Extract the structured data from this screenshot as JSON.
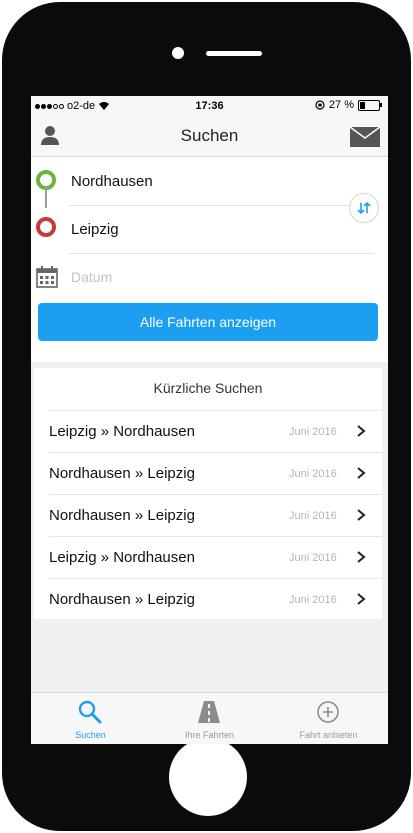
{
  "statusbar": {
    "carrier": "o2-de",
    "time": "17:36",
    "battery": "27 %"
  },
  "navbar": {
    "title": "Suchen"
  },
  "search": {
    "from": "Nordhausen",
    "to": "Leipzig",
    "date_placeholder": "Datum",
    "submit_label": "Alle Fahrten anzeigen"
  },
  "recent": {
    "title": "Kürzliche Suchen",
    "items": [
      {
        "route": "Leipzig » Nordhausen",
        "date": "Juni 2016"
      },
      {
        "route": "Nordhausen » Leipzig",
        "date": "Juni 2016"
      },
      {
        "route": "Nordhausen » Leipzig",
        "date": "Juni 2016"
      },
      {
        "route": "Leipzig » Nordhausen",
        "date": "Juni 2016"
      },
      {
        "route": "Nordhausen » Leipzig",
        "date": "Juni 2016"
      }
    ]
  },
  "tabs": [
    {
      "label": "Suchen",
      "icon": "search-icon",
      "active": true
    },
    {
      "label": "Ihre Fahrten",
      "icon": "road-icon",
      "active": false
    },
    {
      "label": "Fahrt anbieten",
      "icon": "plus-circle-icon",
      "active": false
    }
  ],
  "colors": {
    "accent": "#1c9ff0",
    "origin": "#6db33f",
    "destination": "#c63a3a"
  }
}
